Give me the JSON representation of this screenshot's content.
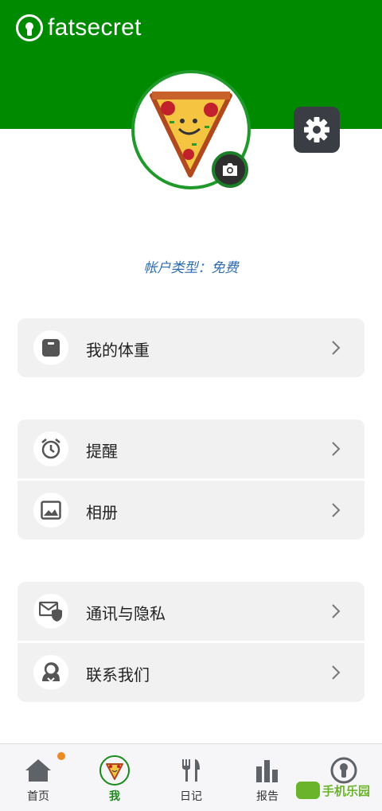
{
  "app": {
    "brand": "fatsecret"
  },
  "profile": {
    "account_type": "帐户类型：免费"
  },
  "menu": {
    "weight": "我的体重",
    "reminders": "提醒",
    "album": "相册",
    "privacy": "通讯与隐私",
    "contact": "联系我们"
  },
  "tabs": [
    {
      "label": "首页",
      "icon": "home-icon"
    },
    {
      "label": "我",
      "icon": "pizza-avatar-icon"
    },
    {
      "label": "日记",
      "icon": "fork-knife-icon"
    },
    {
      "label": "报告",
      "icon": "bar-chart-icon"
    },
    {
      "label": "",
      "icon": "fatsecret-logo-icon"
    }
  ],
  "watermark": {
    "text": "手机乐园"
  },
  "colors": {
    "header": "#008a00",
    "accent_green": "#1a8a1a",
    "card_bg": "#f1f1f1",
    "notification_dot": "#ee8a22"
  }
}
